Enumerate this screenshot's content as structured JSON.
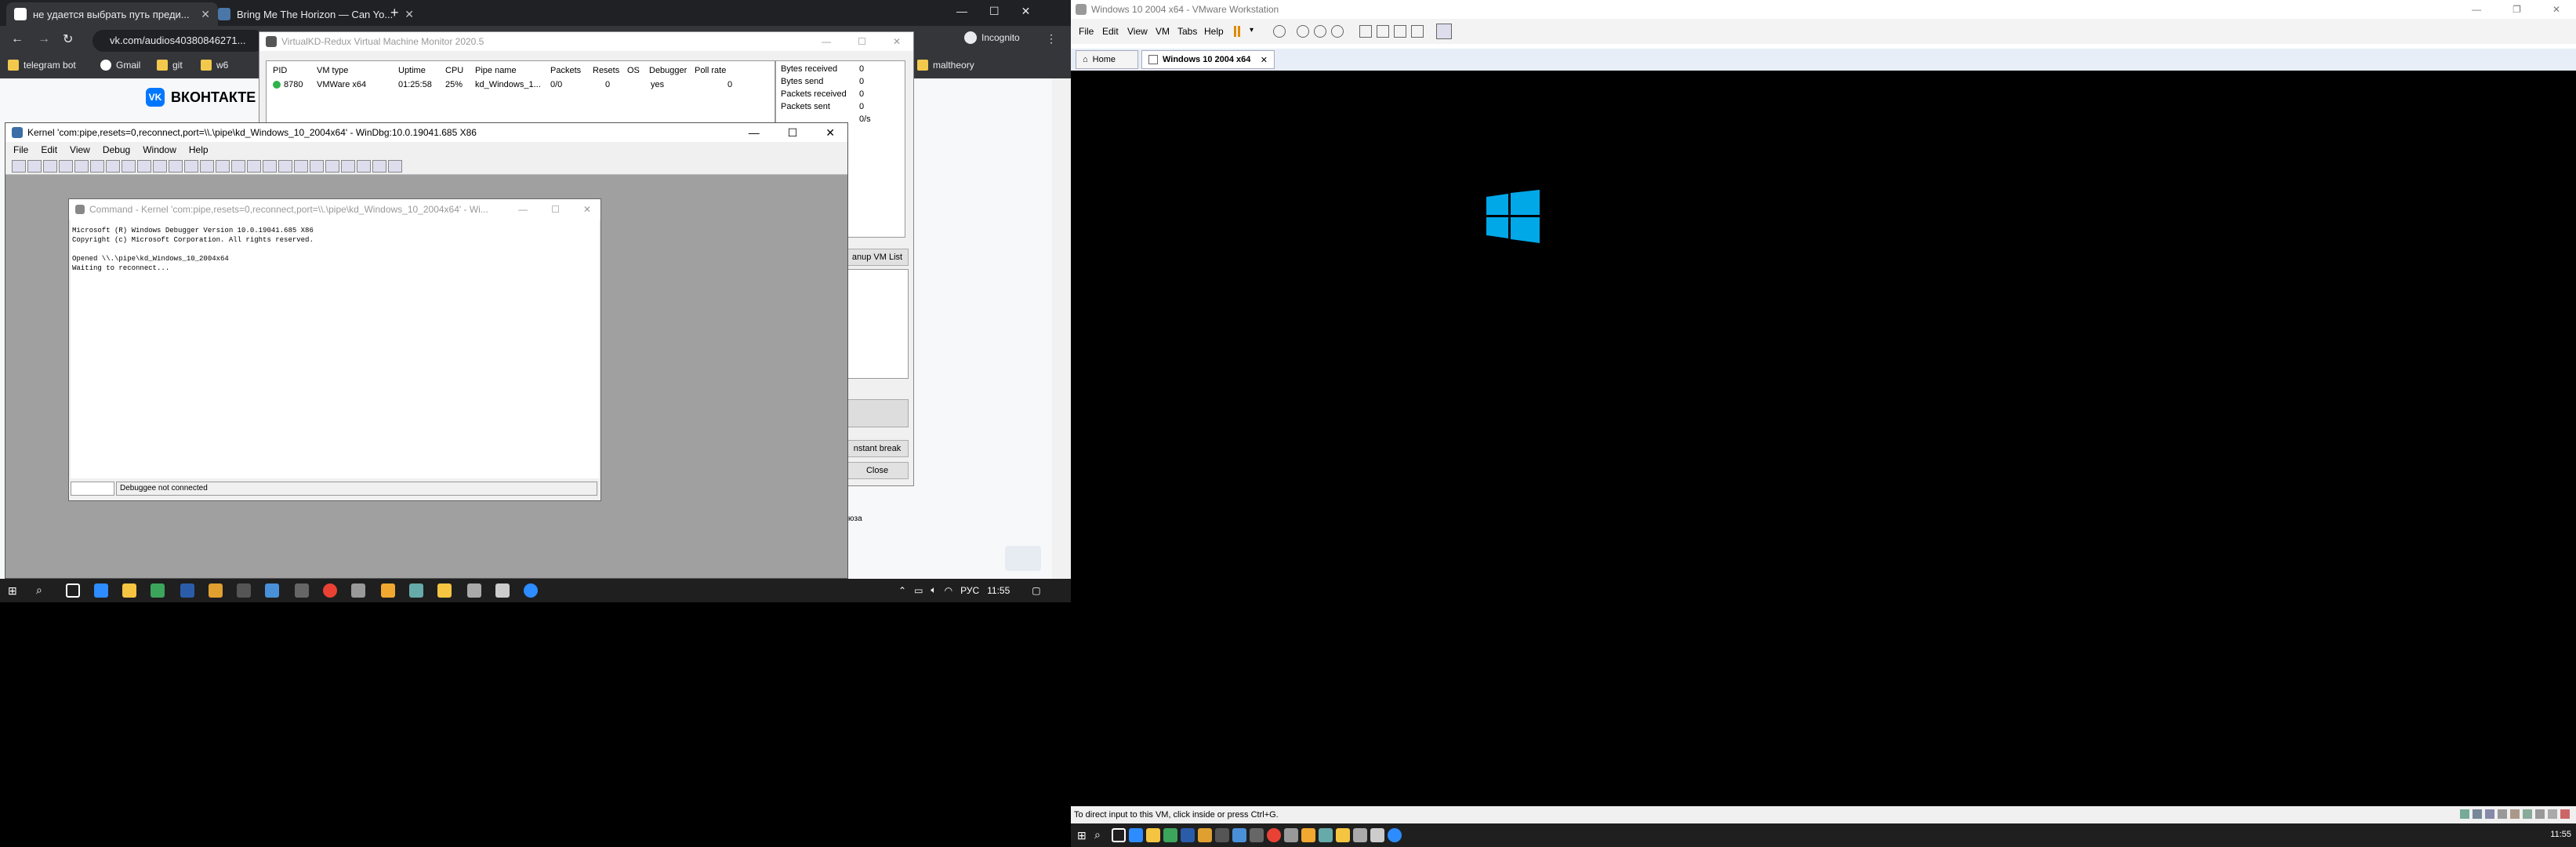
{
  "chrome": {
    "tab1": "не удается выбрать путь преди...",
    "tab2": "Bring Me The Horizon — Can Yo...",
    "url": "vk.com/audios40380846271...",
    "profile": "Incognito",
    "bookmarks": [
      "telegram bot",
      "Gmail",
      "git",
      "w6",
      "maltheory"
    ],
    "vk_brand": "ВКОНТАКТЕ"
  },
  "virtualkd": {
    "title": "VirtualKD-Redux Virtual Machine Monitor 2020.5",
    "columns": [
      "PID",
      "VM type",
      "Uptime",
      "CPU",
      "Pipe name",
      "Packets",
      "Resets",
      "OS",
      "Debugger",
      "Poll rate"
    ],
    "row": [
      "8780",
      "VMWare x64",
      "01:25:58",
      "25%",
      "kd_Windows_1...",
      "0/0",
      "0",
      "yes",
      "",
      "0"
    ],
    "stats": [
      {
        "label": "Bytes received",
        "value": "0"
      },
      {
        "label": "Bytes send",
        "value": "0"
      },
      {
        "label": "Packets received",
        "value": "0"
      },
      {
        "label": "Packets sent",
        "value": "0"
      },
      {
        "label": "",
        "value": "0/s"
      }
    ],
    "cleanup_button": "anup VM List",
    "instant_break_button": "nstant break",
    "close_button": "Close",
    "cut_text": "юза"
  },
  "windbg": {
    "title": "Kernel 'com:pipe,resets=0,reconnect,port=\\\\.\\pipe\\kd_Windows_10_2004x64' - WinDbg:10.0.19041.685 X86",
    "menu": [
      "File",
      "Edit",
      "View",
      "Debug",
      "Window",
      "Help"
    ],
    "command_title": "Command - Kernel 'com:pipe,resets=0,reconnect,port=\\\\.\\pipe\\kd_Windows_10_2004x64' - Wi...",
    "output": [
      "Microsoft (R) Windows Debugger Version 10.0.19041.685 X86",
      "Copyright (c) Microsoft Corporation. All rights reserved.",
      "",
      "Opened \\\\.\\pipe\\kd_Windows_10_2004x64",
      "Waiting to reconnect..."
    ],
    "status": "Debuggee not connected"
  },
  "left_taskbar": {
    "lang": "РУС",
    "time": "11:55"
  },
  "vmware": {
    "title": "Windows 10 2004 x64 - VMware Workstation",
    "menu": [
      "File",
      "Edit",
      "View",
      "VM",
      "Tabs",
      "Help"
    ],
    "tabs": [
      "Home",
      "Windows 10 2004 x64"
    ],
    "status": "To direct input to this VM, click inside or press Ctrl+G.",
    "logo_color": "#00a8e8"
  },
  "right_taskbar": {
    "time": "11:55"
  }
}
